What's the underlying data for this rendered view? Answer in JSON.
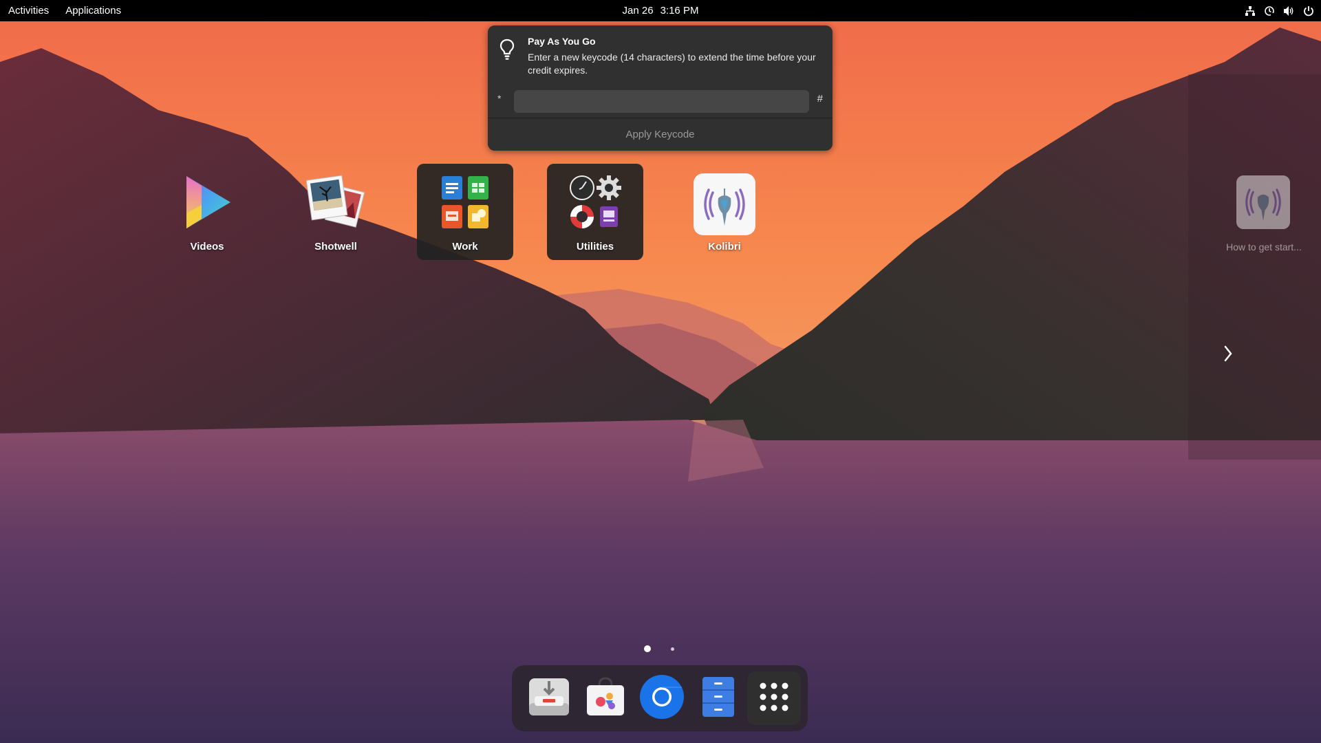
{
  "topbar": {
    "activities": "Activities",
    "applications": "Applications",
    "date": "Jan 26",
    "time": "3:16 PM",
    "tray_icons": [
      "network-icon",
      "payg-icon",
      "volume-icon",
      "power-icon"
    ]
  },
  "notification": {
    "title": "Pay As You Go",
    "body": "Enter a new keycode (14 characters) to extend the time before your credit expires.",
    "prefix": "*",
    "suffix": "#",
    "input_value": "",
    "apply_label": "Apply Keycode",
    "icon": "lightbulb-icon"
  },
  "apps": [
    {
      "label": "Videos",
      "icon": "videos-icon"
    },
    {
      "label": "Shotwell",
      "icon": "shotwell-icon"
    },
    {
      "label": "Work",
      "icon": "work-folder-icon"
    },
    {
      "label": "Utilities",
      "icon": "utilities-folder-icon"
    },
    {
      "label": "Kolibri",
      "icon": "kolibri-icon"
    }
  ],
  "next_page_item": {
    "label": "How to get start...",
    "icon": "kolibri-icon"
  },
  "page_indicator": {
    "pages": 2,
    "current": 1
  },
  "dash": [
    {
      "name": "software-installer-icon"
    },
    {
      "name": "app-center-icon"
    },
    {
      "name": "chromium-icon"
    },
    {
      "name": "files-icon"
    },
    {
      "name": "show-apps-icon"
    }
  ],
  "colors": {
    "topbar": "#000000",
    "notification_bg": "#303030",
    "chromium_blue": "#1a73e8",
    "files_blue": "#3d7de4"
  }
}
